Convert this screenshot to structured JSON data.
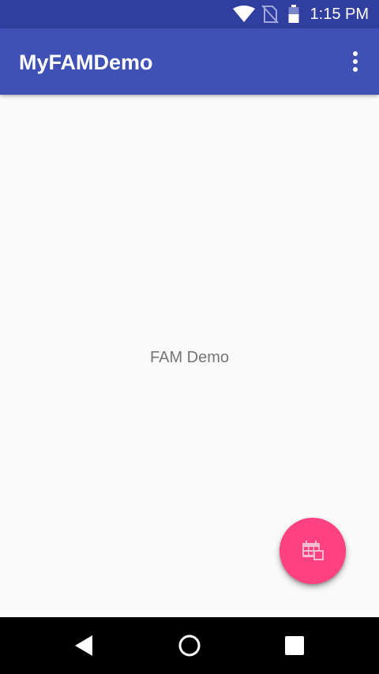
{
  "status_bar": {
    "time": "1:15 PM",
    "icons": [
      "wifi-icon",
      "no-sim-icon",
      "battery-icon"
    ]
  },
  "app_bar": {
    "title": "MyFAMDemo",
    "overflow_icon": "more-vert-icon"
  },
  "content": {
    "text": "FAM Demo"
  },
  "fab": {
    "icon": "calendar-icon",
    "color": "#FF4081"
  },
  "nav_bar": {
    "buttons": [
      "back-icon",
      "home-icon",
      "recents-icon"
    ]
  },
  "colors": {
    "primary": "#3F51B5",
    "primary_dark": "#303F9F",
    "accent": "#FF4081",
    "background": "#FAFAFA"
  }
}
